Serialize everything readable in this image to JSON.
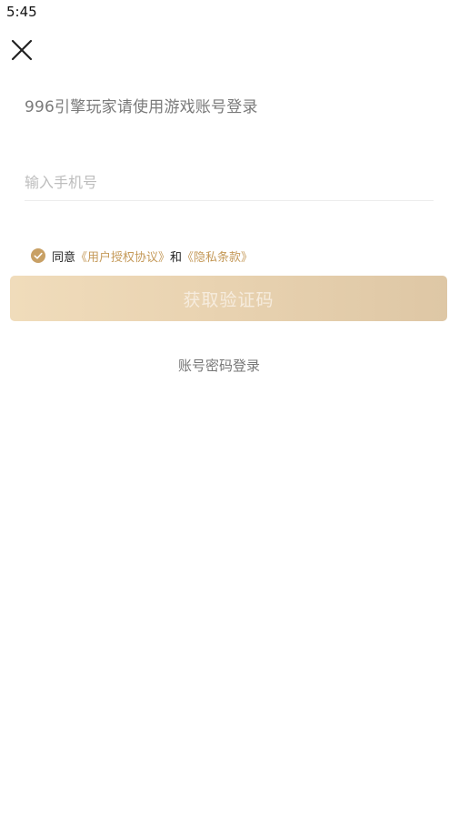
{
  "status_bar": {
    "time": "5:45"
  },
  "header": {
    "close_icon": "close-icon"
  },
  "login": {
    "hint": "996引擎玩家请使用游戏账号登录",
    "phone_placeholder": "输入手机号",
    "phone_value": "",
    "agreement": {
      "checked": true,
      "prefix": "同意",
      "user_agreement": "《用户授权协议》",
      "and": "和",
      "privacy_terms": "《隐私条款》"
    },
    "get_code_label": "获取验证码",
    "password_login_label": "账号密码登录"
  },
  "colors": {
    "accent": "#c59a5a",
    "button_gradient_start": "#f0dcbb",
    "button_gradient_end": "#dec7a5",
    "button_text": "#f6ecde"
  }
}
